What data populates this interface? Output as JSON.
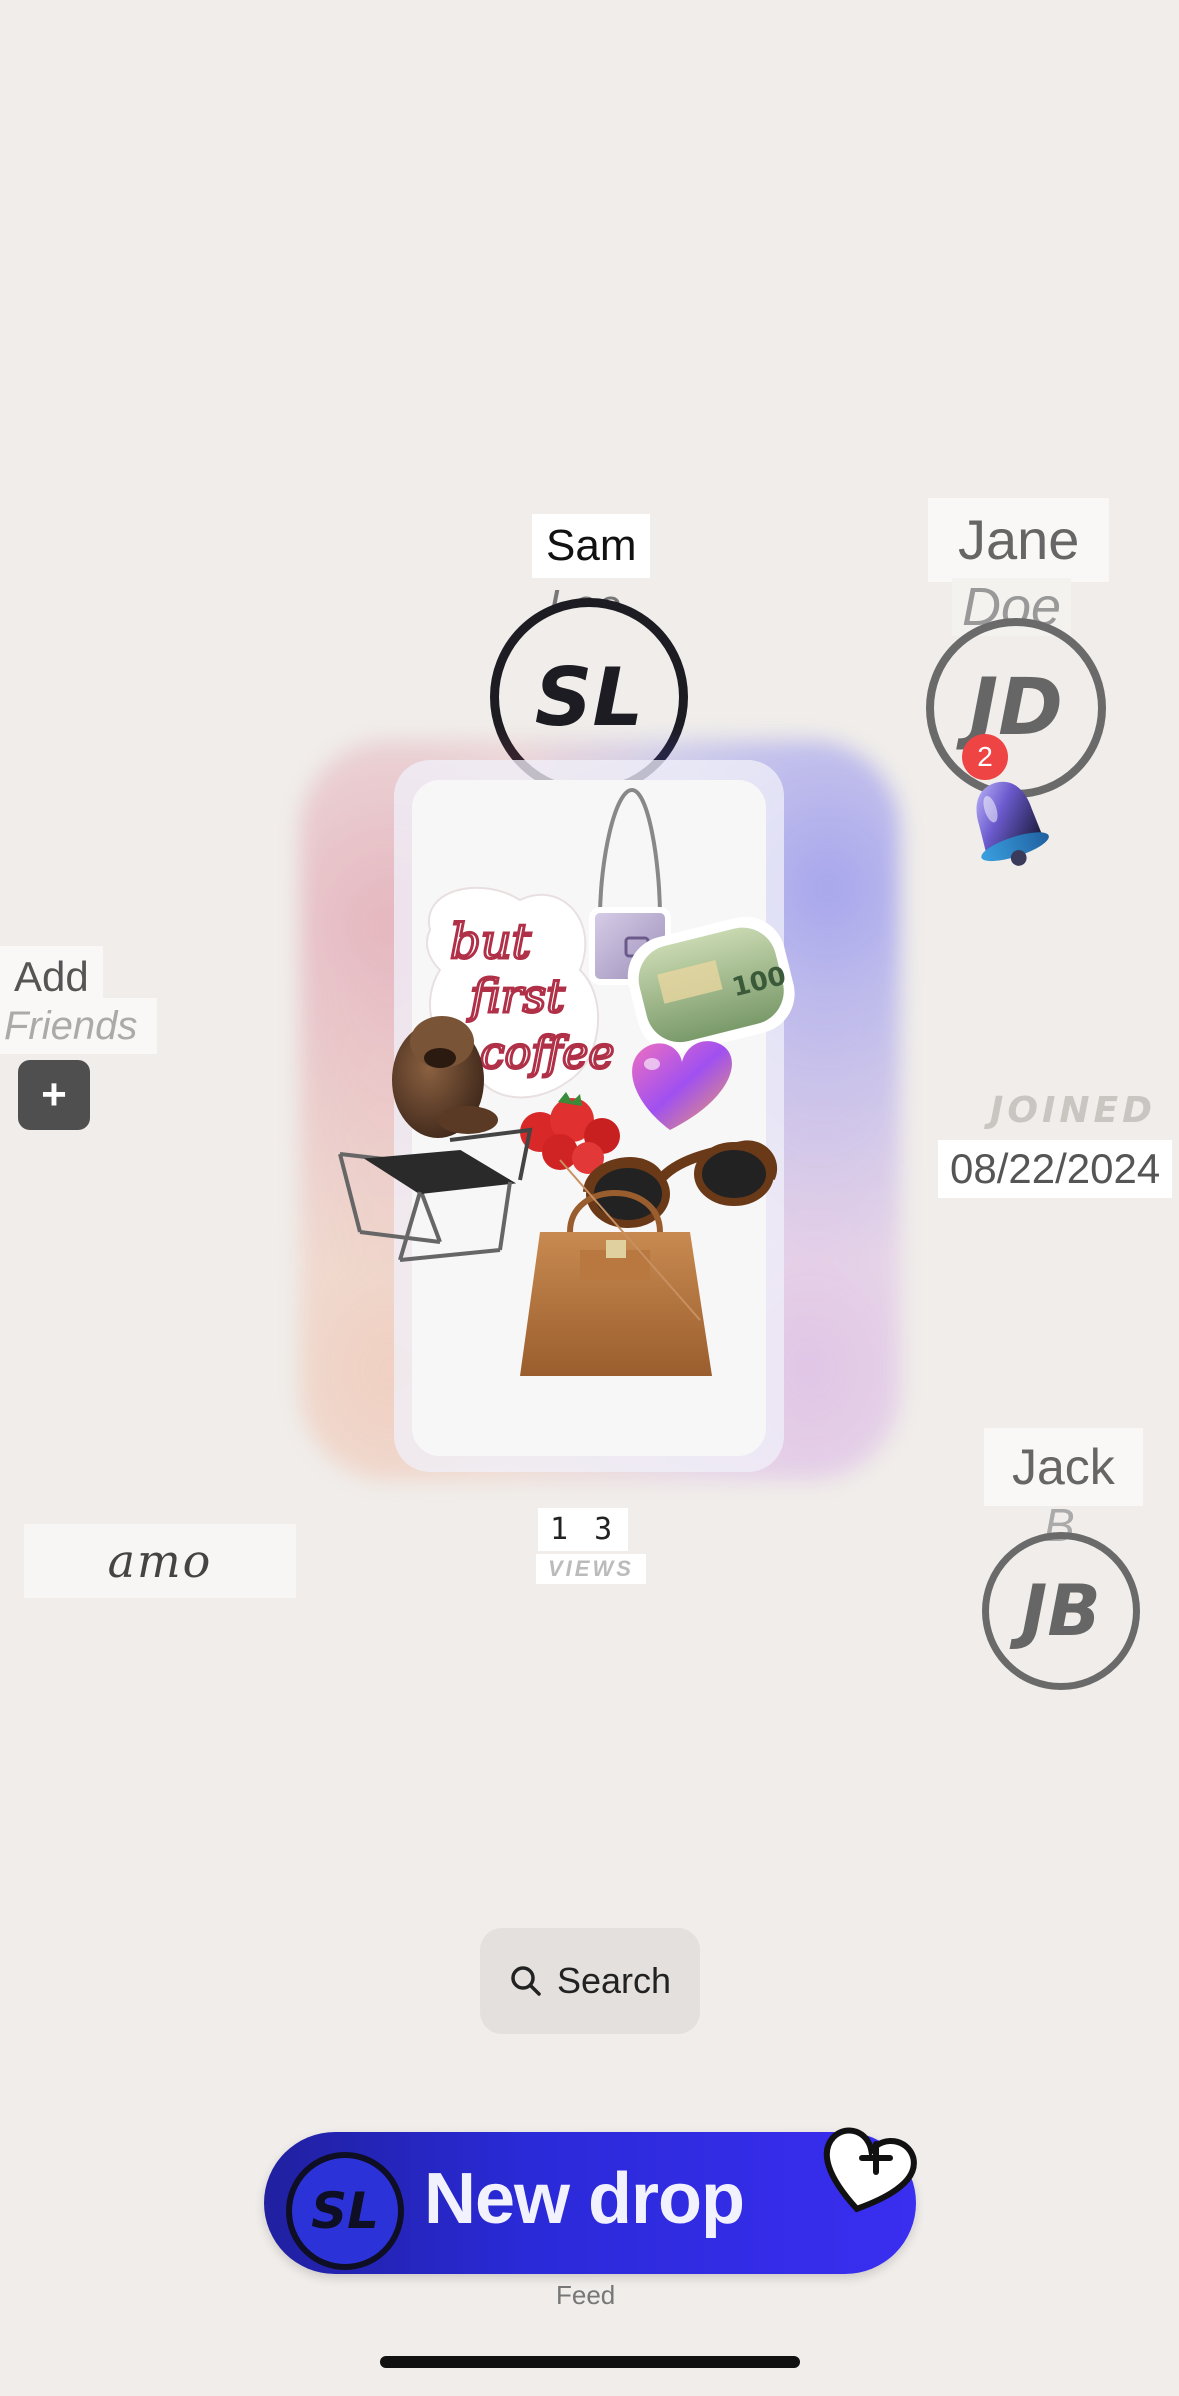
{
  "profile": {
    "first_name": "Sam",
    "last_name": "Lee",
    "initials": "SL",
    "views_count": "1 3",
    "views_label": "VIEWS",
    "joined_label": "JOINED",
    "joined_date": "08/22/2024"
  },
  "friends": [
    {
      "first_name": "Jane",
      "last_name": "Doe",
      "initials": "JD",
      "notification_count": "2"
    },
    {
      "first_name": "Jack",
      "last_name": "B",
      "initials": "JB"
    }
  ],
  "add_friends": {
    "line1": "Add",
    "line2": "Friends",
    "button_symbol": "+"
  },
  "brand_tile": {
    "text": "amo"
  },
  "collage": {
    "items": [
      "handbag-sticker",
      "but-first-coffee-sticker",
      "money-roll-sticker",
      "dog-sticker",
      "strawberries-sticker",
      "heart-sticker",
      "chair-sticker",
      "sunglasses-sticker",
      "tote-bag-sticker"
    ],
    "sticker_text": "but first coffee"
  },
  "search": {
    "label": "Search",
    "icon": "search-icon"
  },
  "new_drop": {
    "label": "New drop",
    "avatar_initials": "SL",
    "icon": "heart-plus-icon",
    "tab_label": "Feed"
  },
  "colors": {
    "background": "#f0edea",
    "new_drop_blue": "#2a2ad8",
    "badge_red": "#ef4444"
  }
}
